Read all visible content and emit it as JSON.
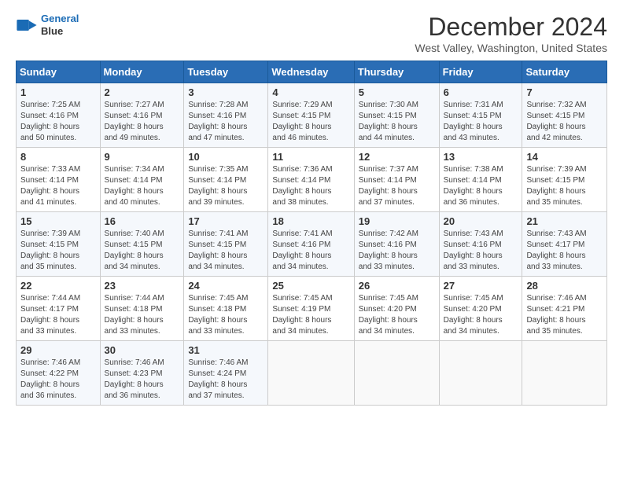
{
  "logo": {
    "line1": "General",
    "line2": "Blue"
  },
  "title": "December 2024",
  "subtitle": "West Valley, Washington, United States",
  "header_days": [
    "Sunday",
    "Monday",
    "Tuesday",
    "Wednesday",
    "Thursday",
    "Friday",
    "Saturday"
  ],
  "weeks": [
    [
      {
        "day": "1",
        "info": "Sunrise: 7:25 AM\nSunset: 4:16 PM\nDaylight: 8 hours\nand 50 minutes."
      },
      {
        "day": "2",
        "info": "Sunrise: 7:27 AM\nSunset: 4:16 PM\nDaylight: 8 hours\nand 49 minutes."
      },
      {
        "day": "3",
        "info": "Sunrise: 7:28 AM\nSunset: 4:16 PM\nDaylight: 8 hours\nand 47 minutes."
      },
      {
        "day": "4",
        "info": "Sunrise: 7:29 AM\nSunset: 4:15 PM\nDaylight: 8 hours\nand 46 minutes."
      },
      {
        "day": "5",
        "info": "Sunrise: 7:30 AM\nSunset: 4:15 PM\nDaylight: 8 hours\nand 44 minutes."
      },
      {
        "day": "6",
        "info": "Sunrise: 7:31 AM\nSunset: 4:15 PM\nDaylight: 8 hours\nand 43 minutes."
      },
      {
        "day": "7",
        "info": "Sunrise: 7:32 AM\nSunset: 4:15 PM\nDaylight: 8 hours\nand 42 minutes."
      }
    ],
    [
      {
        "day": "8",
        "info": "Sunrise: 7:33 AM\nSunset: 4:14 PM\nDaylight: 8 hours\nand 41 minutes."
      },
      {
        "day": "9",
        "info": "Sunrise: 7:34 AM\nSunset: 4:14 PM\nDaylight: 8 hours\nand 40 minutes."
      },
      {
        "day": "10",
        "info": "Sunrise: 7:35 AM\nSunset: 4:14 PM\nDaylight: 8 hours\nand 39 minutes."
      },
      {
        "day": "11",
        "info": "Sunrise: 7:36 AM\nSunset: 4:14 PM\nDaylight: 8 hours\nand 38 minutes."
      },
      {
        "day": "12",
        "info": "Sunrise: 7:37 AM\nSunset: 4:14 PM\nDaylight: 8 hours\nand 37 minutes."
      },
      {
        "day": "13",
        "info": "Sunrise: 7:38 AM\nSunset: 4:14 PM\nDaylight: 8 hours\nand 36 minutes."
      },
      {
        "day": "14",
        "info": "Sunrise: 7:39 AM\nSunset: 4:15 PM\nDaylight: 8 hours\nand 35 minutes."
      }
    ],
    [
      {
        "day": "15",
        "info": "Sunrise: 7:39 AM\nSunset: 4:15 PM\nDaylight: 8 hours\nand 35 minutes."
      },
      {
        "day": "16",
        "info": "Sunrise: 7:40 AM\nSunset: 4:15 PM\nDaylight: 8 hours\nand 34 minutes."
      },
      {
        "day": "17",
        "info": "Sunrise: 7:41 AM\nSunset: 4:15 PM\nDaylight: 8 hours\nand 34 minutes."
      },
      {
        "day": "18",
        "info": "Sunrise: 7:41 AM\nSunset: 4:16 PM\nDaylight: 8 hours\nand 34 minutes."
      },
      {
        "day": "19",
        "info": "Sunrise: 7:42 AM\nSunset: 4:16 PM\nDaylight: 8 hours\nand 33 minutes."
      },
      {
        "day": "20",
        "info": "Sunrise: 7:43 AM\nSunset: 4:16 PM\nDaylight: 8 hours\nand 33 minutes."
      },
      {
        "day": "21",
        "info": "Sunrise: 7:43 AM\nSunset: 4:17 PM\nDaylight: 8 hours\nand 33 minutes."
      }
    ],
    [
      {
        "day": "22",
        "info": "Sunrise: 7:44 AM\nSunset: 4:17 PM\nDaylight: 8 hours\nand 33 minutes."
      },
      {
        "day": "23",
        "info": "Sunrise: 7:44 AM\nSunset: 4:18 PM\nDaylight: 8 hours\nand 33 minutes."
      },
      {
        "day": "24",
        "info": "Sunrise: 7:45 AM\nSunset: 4:18 PM\nDaylight: 8 hours\nand 33 minutes."
      },
      {
        "day": "25",
        "info": "Sunrise: 7:45 AM\nSunset: 4:19 PM\nDaylight: 8 hours\nand 34 minutes."
      },
      {
        "day": "26",
        "info": "Sunrise: 7:45 AM\nSunset: 4:20 PM\nDaylight: 8 hours\nand 34 minutes."
      },
      {
        "day": "27",
        "info": "Sunrise: 7:45 AM\nSunset: 4:20 PM\nDaylight: 8 hours\nand 34 minutes."
      },
      {
        "day": "28",
        "info": "Sunrise: 7:46 AM\nSunset: 4:21 PM\nDaylight: 8 hours\nand 35 minutes."
      }
    ],
    [
      {
        "day": "29",
        "info": "Sunrise: 7:46 AM\nSunset: 4:22 PM\nDaylight: 8 hours\nand 36 minutes."
      },
      {
        "day": "30",
        "info": "Sunrise: 7:46 AM\nSunset: 4:23 PM\nDaylight: 8 hours\nand 36 minutes."
      },
      {
        "day": "31",
        "info": "Sunrise: 7:46 AM\nSunset: 4:24 PM\nDaylight: 8 hours\nand 37 minutes."
      },
      null,
      null,
      null,
      null
    ]
  ]
}
